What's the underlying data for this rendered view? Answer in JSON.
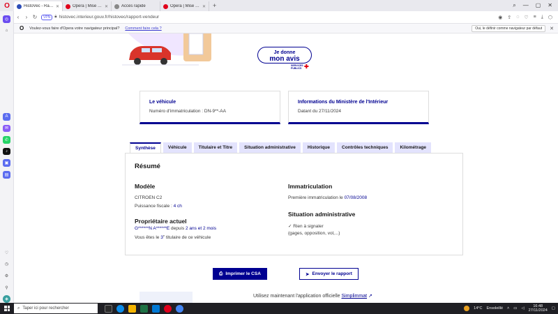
{
  "browser": {
    "tabs": [
      {
        "label": "HistoVec - Rapport vendeur",
        "color": "#2d4eb8",
        "active": true
      },
      {
        "label": "Opera | Mise à jour terminée",
        "color": "#e0001b",
        "active": false
      },
      {
        "label": "Accès rapide",
        "color": "#888888",
        "active": false
      },
      {
        "label": "Opera | Mise à jour terminée",
        "color": "#e0001b",
        "active": false
      }
    ],
    "new_tab": "+",
    "vpn": "VPN",
    "url": "histovec.interieur.gouv.fr/histovec/rapport-vendeur"
  },
  "notification": {
    "message": "Voulez-vous faire d'Opera votre navigateur principal?",
    "link": "Comment faire cela ?",
    "default_button": "Oui, le définir comme navigateur par défaut",
    "close": "✕"
  },
  "hero": {
    "avis_line1": "Je donne",
    "avis_line2": "mon avis",
    "services_line1": "SERVICES",
    "services_line2": "PUBLICS"
  },
  "cards": {
    "vehicle": {
      "title": "Le véhicule",
      "value": "Numéro d'immatriculation : DN-9**-AA"
    },
    "ministry": {
      "title": "Informations du Ministère de l'Intérieur",
      "value": "Datant du 27/11/2024"
    }
  },
  "tabs": [
    "Synthèse",
    "Véhicule",
    "Titulaire et Titre",
    "Situation administrative",
    "Historique",
    "Contrôles techniques",
    "Kilométrage"
  ],
  "summary": {
    "title": "Résumé",
    "model": {
      "heading": "Modèle",
      "name": "CITROEN C2",
      "power_label": "Puissance fiscale : ",
      "power_value": "4 ch"
    },
    "owner": {
      "heading": "Propriétaire actuel",
      "name": "G******N A******E",
      "since_word": " depuis ",
      "since_value": "2 ans et 2 mois",
      "rank_prefix": "Vous êtes le ",
      "rank_value": "3",
      "rank_sup": "e",
      "rank_suffix": " titulaire de ce véhicule"
    },
    "registration": {
      "heading": "Immatriculation",
      "first_label": "Première immatriculation le ",
      "first_date": "07/08/2008"
    },
    "admin": {
      "heading": "Situation administrative",
      "status": "Rien à signaler",
      "detail": "(gages, opposition, vol,...)"
    }
  },
  "actions": {
    "print": "Imprimer le CSA",
    "send": "Envoyer le rapport"
  },
  "promo": {
    "text": "Utilisez maintenant l'application officielle ",
    "link": "Simplimmat"
  },
  "taskbar": {
    "search_placeholder": "Taper ici pour rechercher",
    "temperature": "14°C",
    "weather": "Ensoleillé",
    "time": "16:48",
    "date": "27/11/2024"
  },
  "colors": {
    "primary": "#000091",
    "accent_red": "#e1000f"
  }
}
